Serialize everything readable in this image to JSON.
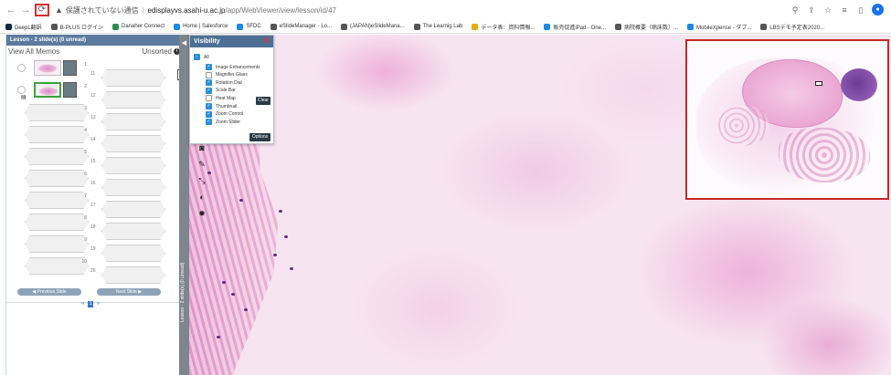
{
  "browser": {
    "security_label": "保護されていない通信",
    "url_host": "edisplayvs.asahi-u.ac.jp",
    "url_path": "/app/WebViewer/view/lesson/id/47",
    "bookmarks": [
      {
        "label": "DeepL翻訳",
        "color": "#0f2b46"
      },
      {
        "label": "B-PLUS ログイン",
        "color": "#555"
      },
      {
        "label": "Danaher Connect",
        "color": "#2e8b57"
      },
      {
        "label": "Home | Salesforce",
        "color": "#1e88e5"
      },
      {
        "label": "SFDC",
        "color": "#1e88e5"
      },
      {
        "label": "eSlideManager - Lo...",
        "color": "#555"
      },
      {
        "label": "(JAPAN)eSlideMana...",
        "color": "#555"
      },
      {
        "label": "The Learnig Lab",
        "color": "#555"
      },
      {
        "label": "データ表：資料情報...",
        "color": "#e0b000"
      },
      {
        "label": "販売促進iPad - One...",
        "color": "#1e88e5"
      },
      {
        "label": "病院概要（病床数）...",
        "color": "#555"
      },
      {
        "label": "MobileXpense - ダブ...",
        "color": "#1e88e5"
      },
      {
        "label": "LBSデモ予定表2020...",
        "color": "#555"
      }
    ]
  },
  "lesson": {
    "header": "Lesson - 2 slide(s) (0 unread)",
    "view_all_memos": "View All Memos",
    "unsorted": "Unsorted",
    "slot_numbers_left": [
      "1",
      "2",
      "3",
      "4",
      "5",
      "6",
      "7",
      "8",
      "9",
      "10"
    ],
    "slot_numbers_right": [
      "11",
      "12",
      "13",
      "14",
      "15",
      "16",
      "17",
      "18",
      "19",
      "20"
    ],
    "prev_label": "◀ Previous Slide",
    "next_label": "Next Slide ▶",
    "page_prev": "«",
    "page_current": "1",
    "page_next": "»",
    "side_tab_label": "Lesson - 2 slide(s) (0 unread)"
  },
  "visibility": {
    "title": "Visibility",
    "all_label": "All",
    "options": [
      {
        "label": "Image Enhancements",
        "checked": true
      },
      {
        "label": "Magnifier Glass",
        "checked": false
      },
      {
        "label": "Rotation Dial",
        "checked": true
      },
      {
        "label": "Scale Bar",
        "checked": true
      },
      {
        "label": "Heat Map",
        "checked": false
      },
      {
        "label": "Thumbnail",
        "checked": true
      },
      {
        "label": "Zoom Control",
        "checked": true
      },
      {
        "label": "Zoom Slider",
        "checked": true
      }
    ],
    "clear_label": "Clear",
    "options_label": "Options"
  },
  "colors": {
    "header_blue": "#5b7a9e",
    "checkbox_blue": "#2d8fd6",
    "overview_border": "#c62828",
    "reload_highlight": "#d32f2f"
  }
}
